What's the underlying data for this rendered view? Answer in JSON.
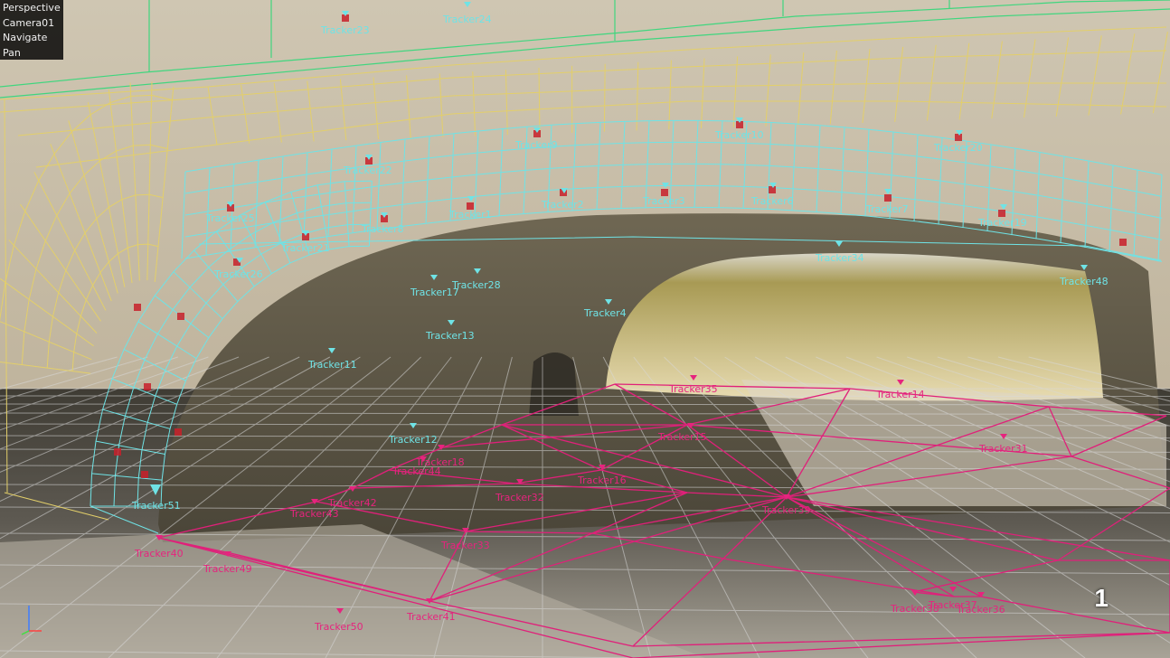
{
  "hud": {
    "view": "Perspective",
    "camera": "Camera01",
    "mode": "Navigate",
    "tool": "Pan"
  },
  "frame_number": "1",
  "colors": {
    "cyan_mesh": "#6fe3e6",
    "yellow_mesh": "#e3cf6a",
    "green_mesh": "#3fd67e",
    "magenta_mesh": "#e0207a",
    "grid": "#d8d8d8"
  },
  "icons": [
    "tracker-marker-icon",
    "axis-gizmo-icon"
  ],
  "trackers_cyan": [
    {
      "label": "Tracker23"
    },
    {
      "label": "Tracker24"
    },
    {
      "label": "Tracker9"
    },
    {
      "label": "Tracker10"
    },
    {
      "label": "Tracker20"
    },
    {
      "label": "Tracker22"
    },
    {
      "label": "Tracker25"
    },
    {
      "label": "Tracker1"
    },
    {
      "label": "Tracker2"
    },
    {
      "label": "Tracker3"
    },
    {
      "label": "Tracker6"
    },
    {
      "label": "Tracker7"
    },
    {
      "label": "Tracker19"
    },
    {
      "label": "Tracker8"
    },
    {
      "label": "Tracker21"
    },
    {
      "label": "Tracker26"
    },
    {
      "label": "Tracker17"
    },
    {
      "label": "Tracker28"
    },
    {
      "label": "Tracker13"
    },
    {
      "label": "Tracker11"
    },
    {
      "label": "Tracker48"
    },
    {
      "label": "Tracker12"
    },
    {
      "label": "Tracker51"
    },
    {
      "label": "Tracker4"
    },
    {
      "label": "Tracker34"
    }
  ],
  "trackers_magenta": [
    {
      "label": "Tracker35"
    },
    {
      "label": "Tracker14"
    },
    {
      "label": "Tracker15"
    },
    {
      "label": "Tracker31"
    },
    {
      "label": "Tracker18"
    },
    {
      "label": "Tracker44"
    },
    {
      "label": "Tracker16"
    },
    {
      "label": "Tracker32"
    },
    {
      "label": "Tracker42"
    },
    {
      "label": "Tracker43"
    },
    {
      "label": "Tracker33"
    },
    {
      "label": "Tracker40"
    },
    {
      "label": "Tracker49"
    },
    {
      "label": "Tracker39"
    },
    {
      "label": "Tracker38"
    },
    {
      "label": "Tracker37"
    },
    {
      "label": "Tracker36"
    },
    {
      "label": "Tracker50"
    },
    {
      "label": "Tracker41"
    }
  ]
}
